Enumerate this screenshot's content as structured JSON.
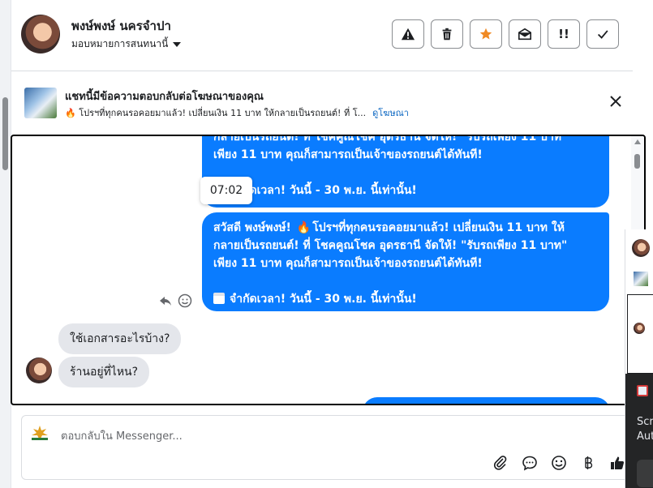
{
  "header": {
    "name": "พงษ์พงษ์ นครจำปา",
    "assign_label": "มอบหมายการสนทนานี้",
    "toolbar": [
      "!",
      "!!",
      "✓"
    ]
  },
  "ad_banner": {
    "title": "แชทนี้มีข้อความตอบกลับต่อโฆษณาของคุณ",
    "subtitle": "🔥 โปรฯที่ทุกคนรอคอยมาแล้ว! เปลี่ยนเงิน 11 บาท ให้กลายเป็นรถยนต์! ที่ โ...",
    "link": "ดูโฆษณา"
  },
  "messages": {
    "out_1": [
      "กลายเป็นรถยนต์! ที่ โชคคูณโชค อุดรธานี จัดให้! \"รับรถเพียง 11 บาท\"",
      "เพียง 11 บาท คุณก็สามารถเป็นเจ้าของรถยนต์ได้ทันที!",
      "",
      "จำกัดเวลา! วันนี้ - 30 พ.ย. นี้เท่านั้น!"
    ],
    "out_2_prefix": "สวัสดี พงษ์พงษ์!",
    "out_2_rest": "โปรฯที่ทุกคนรอคอยมาแล้ว! เปลี่ยนเงิน 11 บาท ให้",
    "out_2": [
      "กลายเป็นรถยนต์! ที่ โชคคูณโชค อุดรธานี จัดให้! \"รับรถเพียง 11 บาท\"",
      "เพียง 11 บาท คุณก็สามารถเป็นเจ้าของรถยนต์ได้ทันที!",
      "",
      "จำกัดเวลา! วันนี้ - 30 พ.ย. นี้เท่านั้น!"
    ],
    "timestamp": "07:02",
    "in_1": "ใช้เอกสารอะไรบ้าง?",
    "in_2": "ร้านอยู่ที่ไหน?"
  },
  "composer": {
    "placeholder": "ตอบกลับใน Messenger..."
  },
  "side_panel": {
    "line1": "Scr",
    "line2": "Aut"
  }
}
